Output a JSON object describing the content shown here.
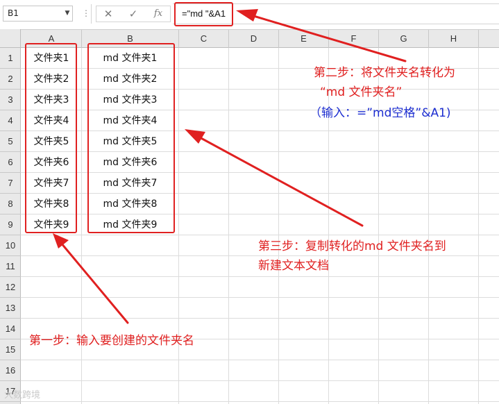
{
  "name_box": {
    "value": "B1"
  },
  "formula_bar": {
    "cancel_glyph": "✕",
    "enter_glyph": "✓",
    "function_glyph": "fx",
    "formula": "=\"md \"&A1"
  },
  "columns": [
    "A",
    "B",
    "C",
    "D",
    "E",
    "F",
    "G",
    "H"
  ],
  "rows": [
    "1",
    "2",
    "3",
    "4",
    "5",
    "6",
    "7",
    "8",
    "9",
    "10",
    "11",
    "12",
    "13",
    "14",
    "15",
    "16",
    "17"
  ],
  "column_a": [
    "文件夹1",
    "文件夹2",
    "文件夹3",
    "文件夹4",
    "文件夹5",
    "文件夹6",
    "文件夹7",
    "文件夹8",
    "文件夹9"
  ],
  "column_b": [
    "md 文件夹1",
    "md 文件夹2",
    "md 文件夹3",
    "md 文件夹4",
    "md 文件夹5",
    "md 文件夹6",
    "md 文件夹7",
    "md 文件夹8",
    "md 文件夹9"
  ],
  "annotations": {
    "step2_line1": "第二步：将文件夹名转化为",
    "step2_line2": "“md 文件夹名”",
    "step2_hint": "（输入：=”md空格”&A1)",
    "step3_line1": "第三步：复制转化的md 文件夹名到",
    "step3_line2": "新建文本文档",
    "step1": "第一步：输入要创建的文件夹名"
  },
  "colors": {
    "annotation_red": "#e02020",
    "annotation_blue": "#1c2dd0",
    "header_gray": "#e9e9e9"
  },
  "watermark": "大数跨境"
}
